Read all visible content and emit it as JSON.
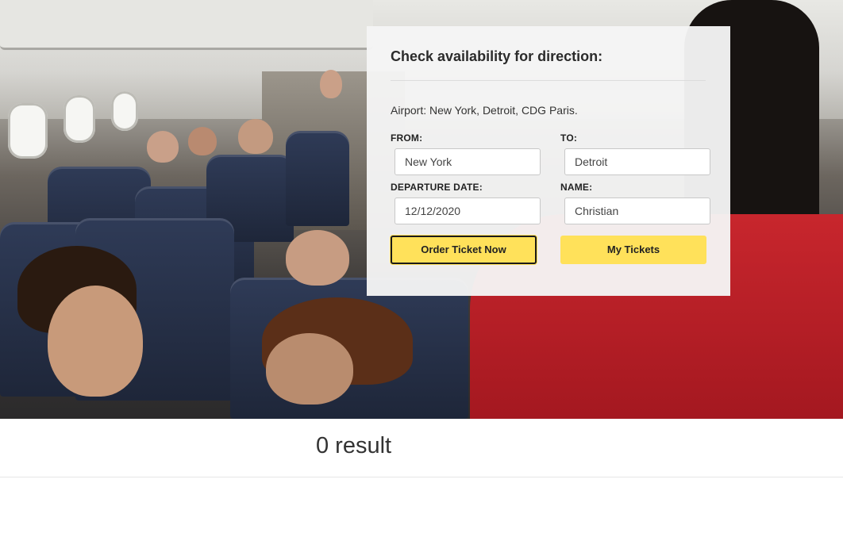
{
  "form": {
    "title": "Check availability for direction:",
    "airport_note": "Airport: New York, Detroit, CDG Paris.",
    "from_label": "FROM:",
    "from_value": "New York",
    "to_label": "TO:",
    "to_value": "Detroit",
    "departure_label": "DEPARTURE DATE:",
    "departure_value": "12/12/2020",
    "name_label": "NAME:",
    "name_value": "Christian",
    "order_button": "Order Ticket Now",
    "tickets_button": "My Tickets"
  },
  "results": {
    "summary": "0 result"
  },
  "colors": {
    "button_bg": "#ffe15a",
    "panel_bg": "#f5f5f5"
  }
}
